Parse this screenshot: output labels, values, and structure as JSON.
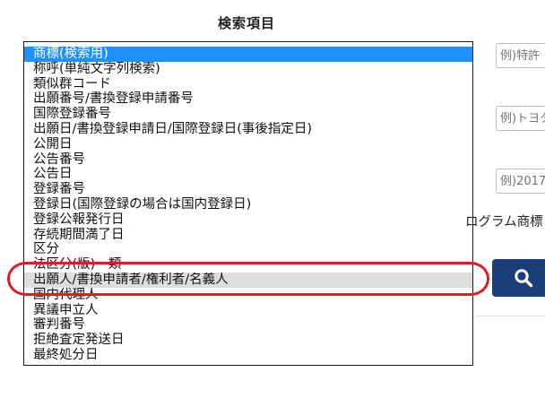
{
  "section": {
    "title": "検索項目"
  },
  "listbox": {
    "options": [
      {
        "label": "商標(検索用)",
        "state": "selected"
      },
      {
        "label": "称呼(単純文字列検索)",
        "state": ""
      },
      {
        "label": "類似群コード",
        "state": ""
      },
      {
        "label": "出願番号/書換登録申請番号",
        "state": ""
      },
      {
        "label": "国際登録番号",
        "state": ""
      },
      {
        "label": "出願日/書換登録申請日/国際登録日(事後指定日)",
        "state": ""
      },
      {
        "label": "公開日",
        "state": ""
      },
      {
        "label": "公告番号",
        "state": ""
      },
      {
        "label": "公告日",
        "state": ""
      },
      {
        "label": "登録番号",
        "state": ""
      },
      {
        "label": "登録日(国際登録の場合は国内登録日)",
        "state": ""
      },
      {
        "label": "登録公報発行日",
        "state": ""
      },
      {
        "label": "存続期間満了日",
        "state": ""
      },
      {
        "label": "区分",
        "state": ""
      },
      {
        "label": "法区分(版)・類",
        "state": ""
      },
      {
        "label": "出願人/書換申請者/権利者/名義人",
        "state": "hover"
      },
      {
        "label": "国内代理人",
        "state": ""
      },
      {
        "label": "異議申立人",
        "state": ""
      },
      {
        "label": "審判番号",
        "state": ""
      },
      {
        "label": "拒絶査定発送日",
        "state": ""
      },
      {
        "label": "最終処分日",
        "state": ""
      }
    ]
  },
  "side": {
    "input1_placeholder": "例)特許",
    "input2_placeholder": "例)トヨタ",
    "input3_placeholder": "例)2017",
    "label": "ログラム商標"
  },
  "colors": {
    "selected_bg": "#1e90ff",
    "hover_bg": "#dedede",
    "annotation": "#e01b24",
    "search_button": "#1b3d7a"
  },
  "icons": {
    "search_button": "magnifier-icon"
  }
}
